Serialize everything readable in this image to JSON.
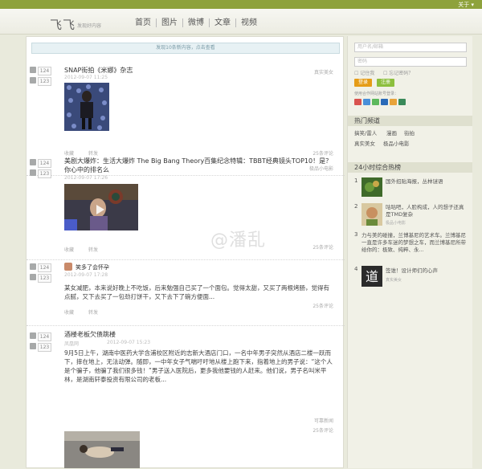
{
  "topbar": {
    "about": "关于 ▾"
  },
  "header": {
    "logo": "飞飞",
    "slogan": "发现好内容",
    "nav": [
      "首页",
      "图片",
      "微博",
      "文章",
      "视频"
    ]
  },
  "main": {
    "new_bar": "发现10条新内容，点击查看",
    "posts": [
      {
        "up": "124",
        "down": "123",
        "title": "SNAP街拍《米娜》杂志",
        "date": "2012-09-07  11:25",
        "tag": "真实美女",
        "favorite": "收藏",
        "share": "转发",
        "comments": "25条评论"
      },
      {
        "up": "124",
        "down": "123",
        "title": "美剧大爆炸：生活大爆炸 The Big Bang Theory百集纪念特辑：TBBT经典镜头TOP10！是？你心中的排名么",
        "date": "2012-09-07  17:26",
        "tag": "极品小电影",
        "favorite": "收藏",
        "share": "转发",
        "comments": "25条评论"
      },
      {
        "up": "124",
        "down": "123",
        "author": "笑多了会怀孕",
        "date": "2012-09-07  17:28",
        "text": "某女减肥，本来说好晚上不吃饭，后来勉强自己买了一个面包。觉得太甜，又买了两根烤肠，觉得有点腻，又下去买了一包劲打饼干，又下去下了碗方便面...",
        "favorite": "收藏",
        "share": "转发",
        "comments": "25条评论"
      },
      {
        "up": "124",
        "down": "123",
        "title": "酒楼老板欠债跳楼",
        "date": "2012-09-07  15:23",
        "author": "凤凰网",
        "text": "9月5日上午，湖南中医药大学含浦校区附近的志新大酒店门口，一名中年男子突然从酒店二楼一跃而下，摔在地上，无法动弹。随即，一中年女子气喘吁吁地从楼上跑下来，指着地上的男子说：“这个人是个骗子，他骗了我们很多钱！”男子送入医院后，更多我他要钱的人赶来。他们说，男子名叫米平林，是湖南轩泰投资有限公司的老板...",
        "tag": "可靠新闻",
        "favorite": "收藏",
        "share": "转发",
        "comments": "25条评论"
      }
    ]
  },
  "sidebar": {
    "login": {
      "username_placeholder": "用户名/邮箱",
      "password_placeholder": "密码",
      "remember": "记住我",
      "forgot": "忘记密码？",
      "login_label": "登录",
      "register_label": "注册",
      "partner_note": "使用合作网站账号登录："
    },
    "channels": {
      "title": "热门频道",
      "items": [
        "搞笑/雷人",
        "漫画",
        "街拍",
        "真实美女",
        "极品小电影"
      ]
    },
    "hot": {
      "title": "24小时综合热榜",
      "items": [
        {
          "n": "1",
          "title": "国外招贴海报，丛林谜语"
        },
        {
          "n": "2",
          "title": "咕咕吧，人脸构成，人的想子还真是TMD复杂",
          "sub": "极品小电影"
        },
        {
          "n": "3",
          "title": "力与美的碰撞，兰博基尼的艺术车。兰博基尼一直是许多车迷的梦想之车，而兰博基尼所带给你的：极致、纯粹、永..."
        },
        {
          "n": "4",
          "title": "签谁！设计师们的心声",
          "sub": "真实美女"
        }
      ]
    }
  },
  "watermark": "@潘乱",
  "colors": {
    "accent_green": "#8ea23c",
    "login_orange": "#e59c17",
    "register_green": "#8cbf3d"
  }
}
